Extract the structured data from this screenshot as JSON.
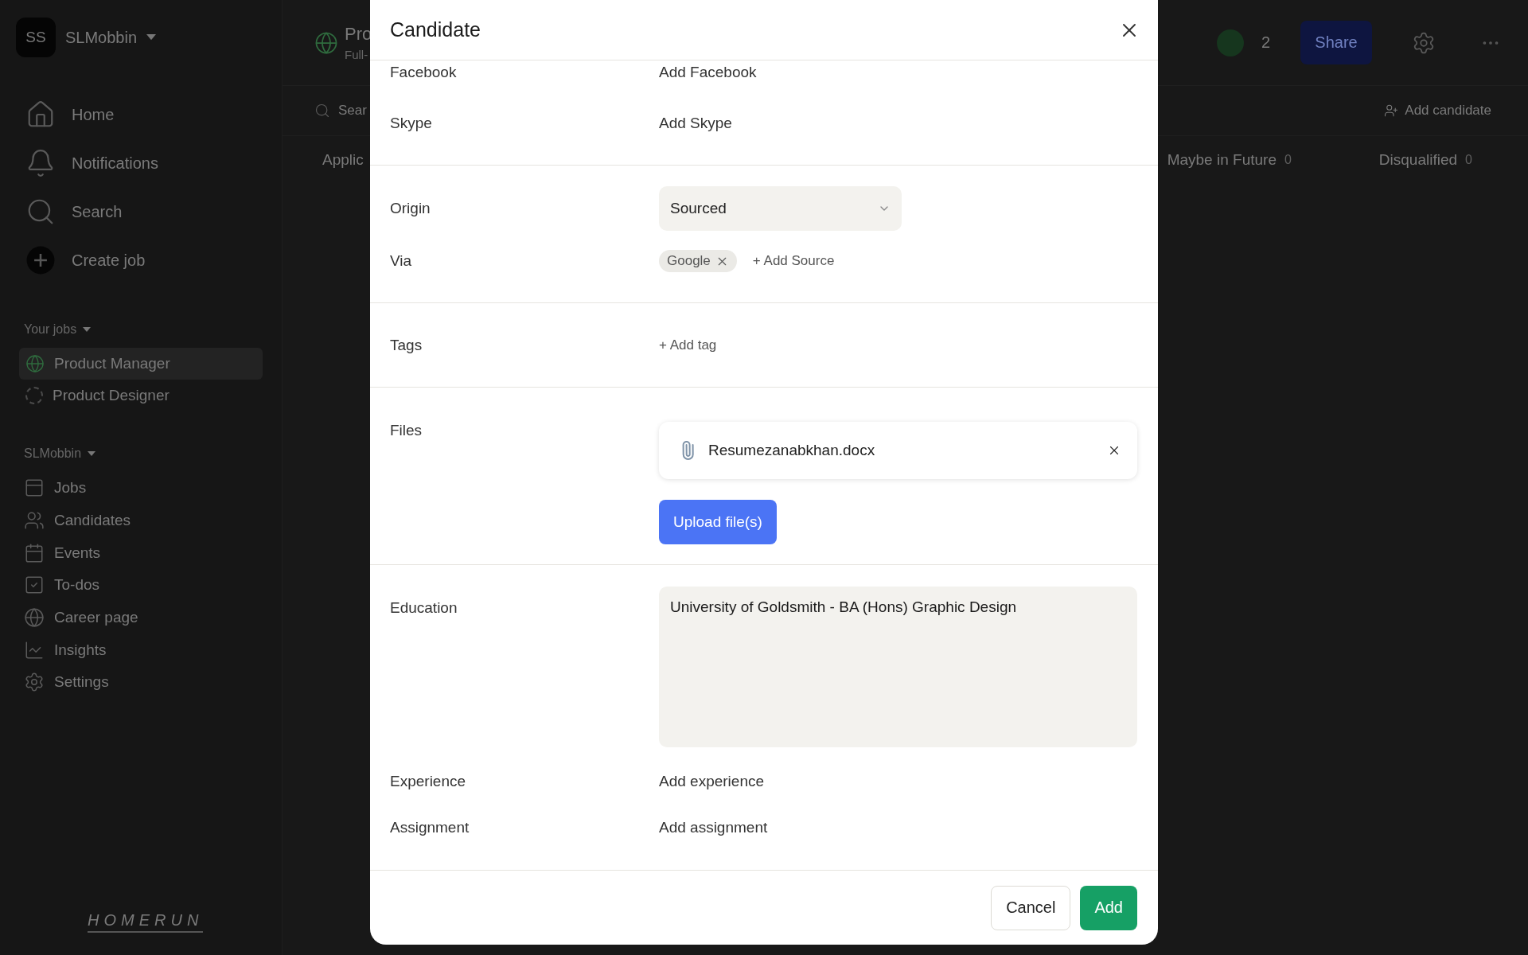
{
  "sidebar": {
    "workspace": {
      "initials": "SS",
      "name": "SLMobbin"
    },
    "nav": [
      {
        "kind": "home",
        "label": "Home"
      },
      {
        "kind": "bell",
        "label": "Notifications"
      },
      {
        "kind": "search",
        "label": "Search"
      },
      {
        "kind": "create",
        "label": "Create job"
      }
    ],
    "your_jobs": {
      "heading": "Your jobs",
      "items": [
        {
          "kind": "published",
          "label": "Product Manager",
          "selected": true
        },
        {
          "kind": "draft",
          "label": "Product Designer",
          "selected": false
        }
      ]
    },
    "company": {
      "heading": "SLMobbin",
      "items": [
        {
          "kind": "jobs",
          "label": "Jobs"
        },
        {
          "kind": "candidates",
          "label": "Candidates"
        },
        {
          "kind": "events",
          "label": "Events"
        },
        {
          "kind": "todos",
          "label": "To-dos"
        },
        {
          "kind": "career",
          "label": "Career page"
        },
        {
          "kind": "insights",
          "label": "Insights"
        },
        {
          "kind": "settings",
          "label": "Settings"
        }
      ]
    },
    "logo": "HOMERUN"
  },
  "header": {
    "title": "Pro",
    "subtitle": "Full-",
    "collaborators": "2",
    "share": "Share"
  },
  "toolbar": {
    "search": "Sear",
    "add_candidate": "Add candidate"
  },
  "stages": [
    {
      "label": "Applic"
    },
    {
      "label": "Maybe in Future",
      "count": "0"
    },
    {
      "label": "Disqualified",
      "count": "0"
    }
  ],
  "modal": {
    "title": "Candidate",
    "sections": [
      {
        "rows": [
          {
            "kind": "link",
            "label": "Facebook",
            "action": "Add Facebook"
          },
          {
            "kind": "link",
            "label": "Skype",
            "action": "Add Skype"
          }
        ]
      },
      {
        "rows": [
          {
            "kind": "select",
            "label": "Origin",
            "value": "Sourced"
          },
          {
            "kind": "chips",
            "label": "Via",
            "chips": [
              "Google"
            ],
            "action": "+ Add Source"
          }
        ]
      },
      {
        "rows": [
          {
            "kind": "chips",
            "label": "Tags",
            "action": "+ Add tag"
          }
        ]
      },
      {
        "rows": [
          {
            "kind": "files",
            "label": "Files",
            "files": [
              "Resumezanabkhan.docx"
            ],
            "action": "Upload file(s)"
          }
        ]
      },
      {
        "rows": [
          {
            "kind": "textarea",
            "label": "Education",
            "value": "University of Goldsmith - BA (Hons) Graphic Design"
          },
          {
            "kind": "link",
            "label": "Experience",
            "action": "Add experience"
          },
          {
            "kind": "link",
            "label": "Assignment",
            "action": "Add assignment"
          }
        ]
      }
    ],
    "buttons": [
      {
        "kind": "secondary",
        "label": "Cancel"
      },
      {
        "kind": "primary",
        "label": "Add"
      }
    ]
  }
}
